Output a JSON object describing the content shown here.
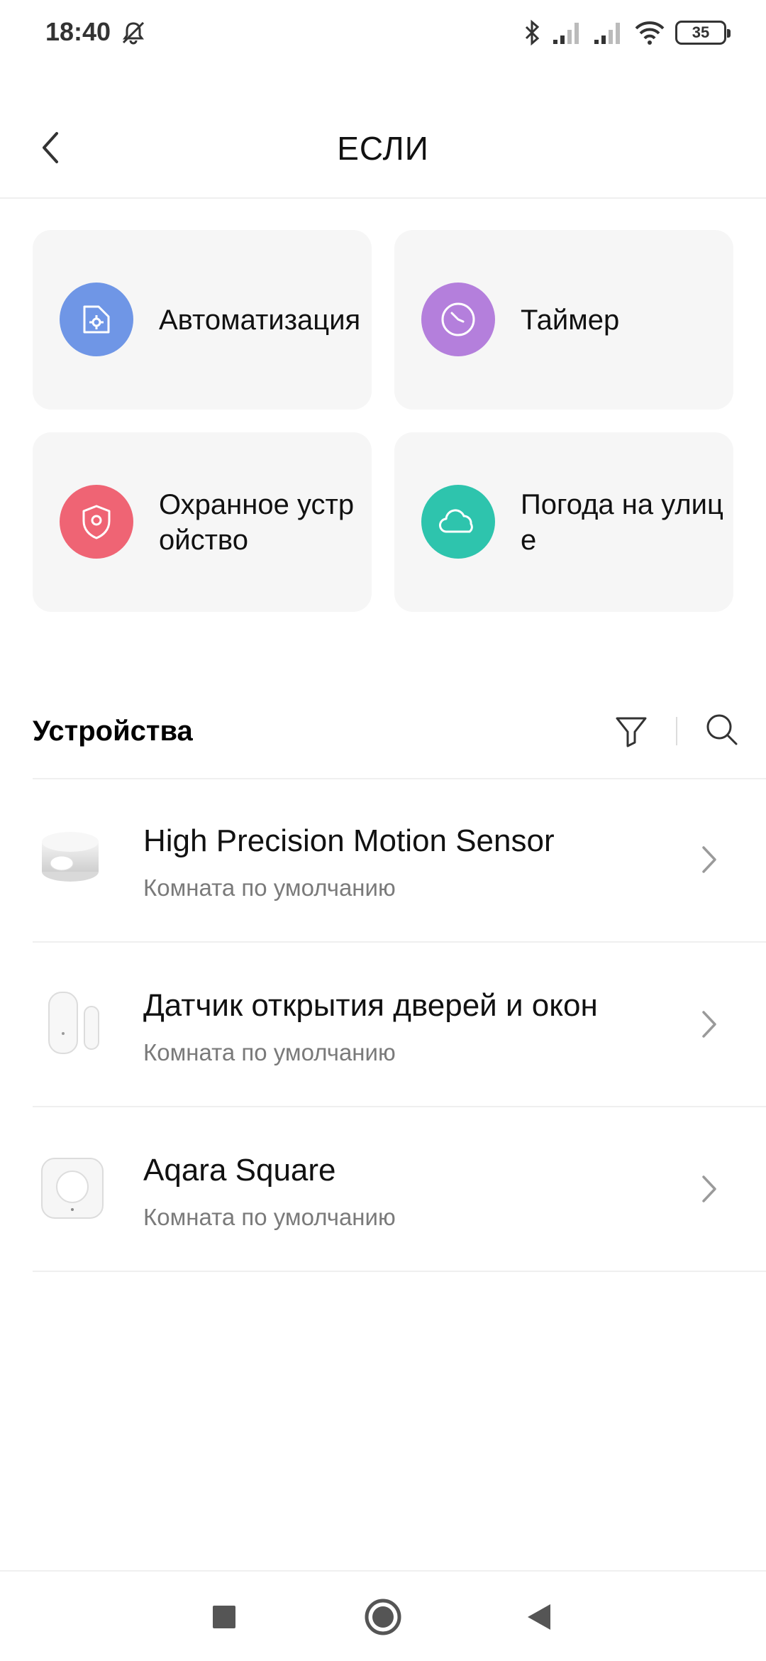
{
  "status_bar": {
    "time": "18:40",
    "battery": "35",
    "icons": [
      "alarm-off-icon",
      "bluetooth-icon",
      "signal-icon",
      "signal-icon",
      "wifi-icon",
      "battery-icon"
    ]
  },
  "header": {
    "title": "ЕСЛИ",
    "back_icon": "back-arrow-icon"
  },
  "conditions": [
    {
      "label": "Автоматизация",
      "icon": "automation-icon",
      "color": "#6f96e6"
    },
    {
      "label": "Таймер",
      "icon": "clock-icon",
      "color": "#b47fdc"
    },
    {
      "label": "Охранное устройство",
      "icon": "shield-icon",
      "color": "#ef6474"
    },
    {
      "label": "Погода на улице",
      "icon": "cloud-icon",
      "color": "#2ec4ad"
    }
  ],
  "devices_section": {
    "title": "Устройства",
    "filter_icon": "filter-icon",
    "search_icon": "search-icon"
  },
  "devices": [
    {
      "name": "High Precision Motion Sensor",
      "room": "Комната по умолчанию",
      "icon": "motion-sensor-icon"
    },
    {
      "name": "Датчик открытия дверей и окон",
      "room": "Комната по умолчанию",
      "icon": "door-sensor-icon"
    },
    {
      "name": "Aqara Square",
      "room": "Комната по умолчанию",
      "icon": "square-button-icon"
    }
  ],
  "nav_bar": {
    "buttons": [
      "recents-icon",
      "home-icon",
      "back-icon"
    ]
  }
}
